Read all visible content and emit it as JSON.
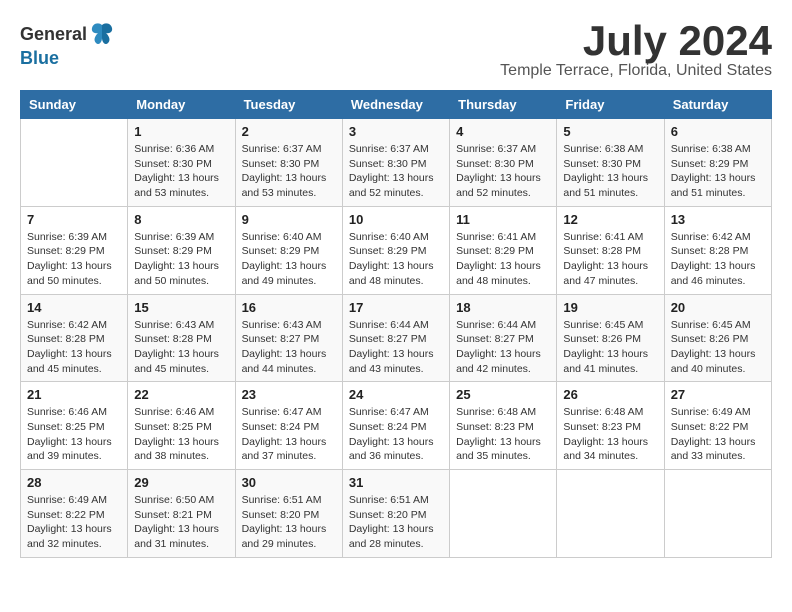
{
  "logo": {
    "general": "General",
    "blue": "Blue"
  },
  "title": "July 2024",
  "subtitle": "Temple Terrace, Florida, United States",
  "days_of_week": [
    "Sunday",
    "Monday",
    "Tuesday",
    "Wednesday",
    "Thursday",
    "Friday",
    "Saturday"
  ],
  "weeks": [
    [
      {
        "day": "",
        "info": ""
      },
      {
        "day": "1",
        "info": "Sunrise: 6:36 AM\nSunset: 8:30 PM\nDaylight: 13 hours\nand 53 minutes."
      },
      {
        "day": "2",
        "info": "Sunrise: 6:37 AM\nSunset: 8:30 PM\nDaylight: 13 hours\nand 53 minutes."
      },
      {
        "day": "3",
        "info": "Sunrise: 6:37 AM\nSunset: 8:30 PM\nDaylight: 13 hours\nand 52 minutes."
      },
      {
        "day": "4",
        "info": "Sunrise: 6:37 AM\nSunset: 8:30 PM\nDaylight: 13 hours\nand 52 minutes."
      },
      {
        "day": "5",
        "info": "Sunrise: 6:38 AM\nSunset: 8:30 PM\nDaylight: 13 hours\nand 51 minutes."
      },
      {
        "day": "6",
        "info": "Sunrise: 6:38 AM\nSunset: 8:29 PM\nDaylight: 13 hours\nand 51 minutes."
      }
    ],
    [
      {
        "day": "7",
        "info": "Sunrise: 6:39 AM\nSunset: 8:29 PM\nDaylight: 13 hours\nand 50 minutes."
      },
      {
        "day": "8",
        "info": "Sunrise: 6:39 AM\nSunset: 8:29 PM\nDaylight: 13 hours\nand 50 minutes."
      },
      {
        "day": "9",
        "info": "Sunrise: 6:40 AM\nSunset: 8:29 PM\nDaylight: 13 hours\nand 49 minutes."
      },
      {
        "day": "10",
        "info": "Sunrise: 6:40 AM\nSunset: 8:29 PM\nDaylight: 13 hours\nand 48 minutes."
      },
      {
        "day": "11",
        "info": "Sunrise: 6:41 AM\nSunset: 8:29 PM\nDaylight: 13 hours\nand 48 minutes."
      },
      {
        "day": "12",
        "info": "Sunrise: 6:41 AM\nSunset: 8:28 PM\nDaylight: 13 hours\nand 47 minutes."
      },
      {
        "day": "13",
        "info": "Sunrise: 6:42 AM\nSunset: 8:28 PM\nDaylight: 13 hours\nand 46 minutes."
      }
    ],
    [
      {
        "day": "14",
        "info": "Sunrise: 6:42 AM\nSunset: 8:28 PM\nDaylight: 13 hours\nand 45 minutes."
      },
      {
        "day": "15",
        "info": "Sunrise: 6:43 AM\nSunset: 8:28 PM\nDaylight: 13 hours\nand 45 minutes."
      },
      {
        "day": "16",
        "info": "Sunrise: 6:43 AM\nSunset: 8:27 PM\nDaylight: 13 hours\nand 44 minutes."
      },
      {
        "day": "17",
        "info": "Sunrise: 6:44 AM\nSunset: 8:27 PM\nDaylight: 13 hours\nand 43 minutes."
      },
      {
        "day": "18",
        "info": "Sunrise: 6:44 AM\nSunset: 8:27 PM\nDaylight: 13 hours\nand 42 minutes."
      },
      {
        "day": "19",
        "info": "Sunrise: 6:45 AM\nSunset: 8:26 PM\nDaylight: 13 hours\nand 41 minutes."
      },
      {
        "day": "20",
        "info": "Sunrise: 6:45 AM\nSunset: 8:26 PM\nDaylight: 13 hours\nand 40 minutes."
      }
    ],
    [
      {
        "day": "21",
        "info": "Sunrise: 6:46 AM\nSunset: 8:25 PM\nDaylight: 13 hours\nand 39 minutes."
      },
      {
        "day": "22",
        "info": "Sunrise: 6:46 AM\nSunset: 8:25 PM\nDaylight: 13 hours\nand 38 minutes."
      },
      {
        "day": "23",
        "info": "Sunrise: 6:47 AM\nSunset: 8:24 PM\nDaylight: 13 hours\nand 37 minutes."
      },
      {
        "day": "24",
        "info": "Sunrise: 6:47 AM\nSunset: 8:24 PM\nDaylight: 13 hours\nand 36 minutes."
      },
      {
        "day": "25",
        "info": "Sunrise: 6:48 AM\nSunset: 8:23 PM\nDaylight: 13 hours\nand 35 minutes."
      },
      {
        "day": "26",
        "info": "Sunrise: 6:48 AM\nSunset: 8:23 PM\nDaylight: 13 hours\nand 34 minutes."
      },
      {
        "day": "27",
        "info": "Sunrise: 6:49 AM\nSunset: 8:22 PM\nDaylight: 13 hours\nand 33 minutes."
      }
    ],
    [
      {
        "day": "28",
        "info": "Sunrise: 6:49 AM\nSunset: 8:22 PM\nDaylight: 13 hours\nand 32 minutes."
      },
      {
        "day": "29",
        "info": "Sunrise: 6:50 AM\nSunset: 8:21 PM\nDaylight: 13 hours\nand 31 minutes."
      },
      {
        "day": "30",
        "info": "Sunrise: 6:51 AM\nSunset: 8:20 PM\nDaylight: 13 hours\nand 29 minutes."
      },
      {
        "day": "31",
        "info": "Sunrise: 6:51 AM\nSunset: 8:20 PM\nDaylight: 13 hours\nand 28 minutes."
      },
      {
        "day": "",
        "info": ""
      },
      {
        "day": "",
        "info": ""
      },
      {
        "day": "",
        "info": ""
      }
    ]
  ]
}
